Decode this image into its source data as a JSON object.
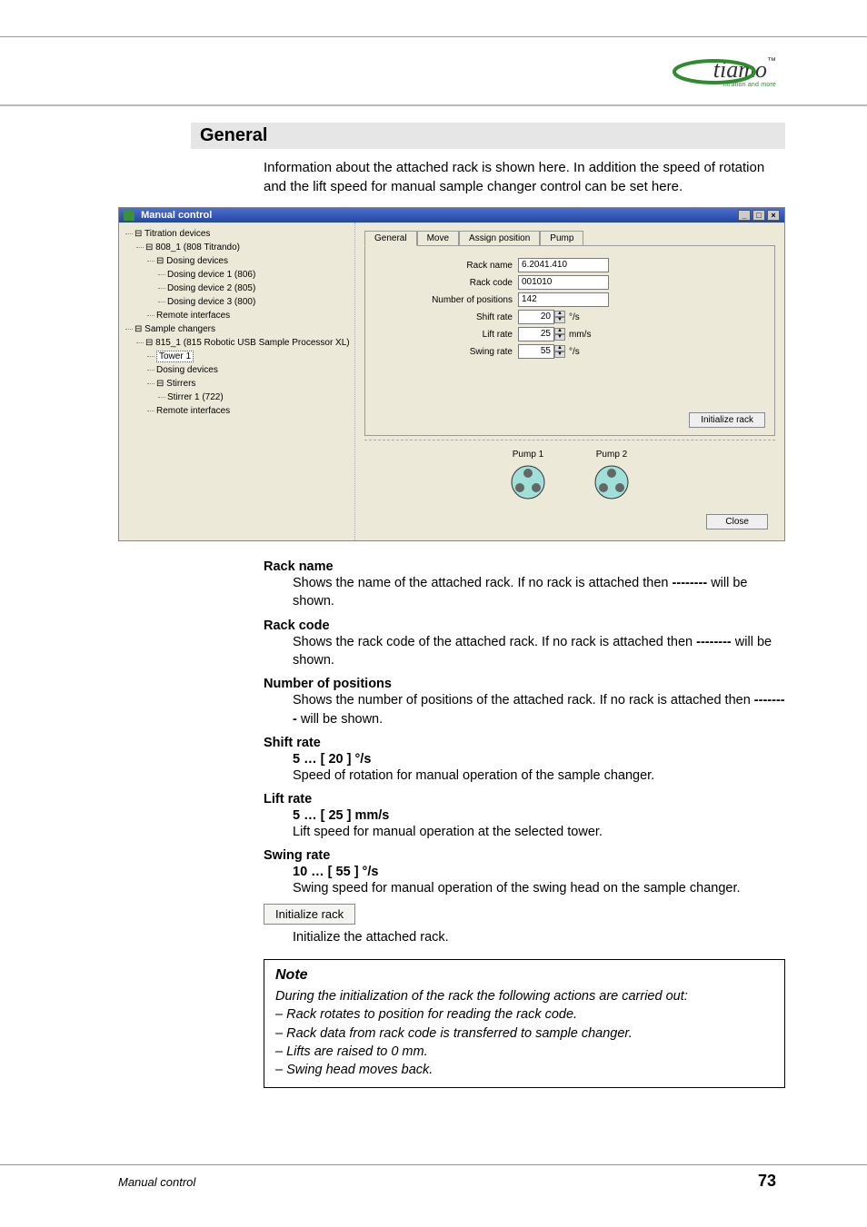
{
  "logo": {
    "brand": "tiamo",
    "tm": "™",
    "tag": "titration and more"
  },
  "section_title": "General",
  "intro": "Information about the attached rack is shown here. In addition the speed of rotation and the lift speed for manual sample changer control can be set here.",
  "window": {
    "title": "Manual control",
    "tree": {
      "n0": "Titration devices",
      "n1": "808_1 (808 Titrando)",
      "n2": "Dosing devices",
      "n3": "Dosing device 1 (806)",
      "n4": "Dosing device 2 (805)",
      "n5": "Dosing device 3 (800)",
      "n6": "Remote interfaces",
      "n7": "Sample changers",
      "n8": "815_1 (815 Robotic USB Sample Processor XL)",
      "n9": "Tower 1",
      "n10": "Dosing devices",
      "n11": "Stirrers",
      "n12": "Stirrer 1 (722)",
      "n13": "Remote interfaces"
    },
    "tabs": {
      "t0": "General",
      "t1": "Move",
      "t2": "Assign position",
      "t3": "Pump"
    },
    "form": {
      "rack_name_lbl": "Rack name",
      "rack_name_val": "6.2041.410",
      "rack_code_lbl": "Rack code",
      "rack_code_val": "001010",
      "num_pos_lbl": "Number of positions",
      "num_pos_val": "142",
      "shift_lbl": "Shift rate",
      "shift_val": "20",
      "shift_unit": "°/s",
      "lift_lbl": "Lift rate",
      "lift_val": "25",
      "lift_unit": "mm/s",
      "swing_lbl": "Swing rate",
      "swing_val": "55",
      "swing_unit": "°/s",
      "init_btn": "Initialize rack"
    },
    "pumps": {
      "p1": "Pump 1",
      "p2": "Pump 2"
    },
    "close": "Close"
  },
  "defs": {
    "rack_name": "Rack name",
    "rack_name_desc_a": "Shows the name of the attached rack. If no rack is attached then ",
    "rack_name_dash": "--------",
    "rack_name_desc_b": " will be shown.",
    "rack_code": "Rack code",
    "rack_code_desc_a": "Shows the rack code of the attached rack. If no rack is attached then ",
    "rack_code_dash": "--------",
    "rack_code_desc_b": " will be shown.",
    "num_pos": "Number of positions",
    "num_pos_desc_a": "Shows the number of positions of the attached rack. If no rack is attached then ",
    "num_pos_dash": "--------",
    "num_pos_desc_b": " will be shown.",
    "shift": "Shift rate",
    "shift_range": "5 … [ 20 ] °/s",
    "shift_desc": "Speed of rotation for manual operation of the sample changer.",
    "lift": "Lift rate",
    "lift_range": "5 … [ 25 ] mm/s",
    "lift_desc": "Lift speed for manual operation at the selected tower.",
    "swing": "Swing rate",
    "swing_range": "10 … [ 55 ] °/s",
    "swing_desc": "Swing speed for manual operation of the swing head on the sample changer.",
    "init_btn_label": "Initialize rack",
    "init_desc": "Initialize the attached rack."
  },
  "note": {
    "heading": "Note",
    "line1": "During the initialization of the rack the following actions are carried out:",
    "b1": "– Rack rotates to position for reading the rack code.",
    "b2": "– Rack data from rack code is transferred to sample changer.",
    "b3": "– Lifts are raised to 0 mm.",
    "b4": "– Swing head moves back."
  },
  "footer": {
    "title": "Manual control",
    "page": "73"
  }
}
